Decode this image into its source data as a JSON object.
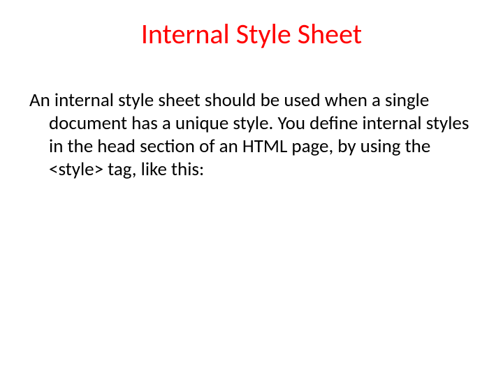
{
  "slide": {
    "title": "Internal Style Sheet",
    "paragraph": "An internal style sheet should be used when a single document has a unique style. You define internal styles in the head section of an HTML page, by using the <style> tag, like this:"
  }
}
